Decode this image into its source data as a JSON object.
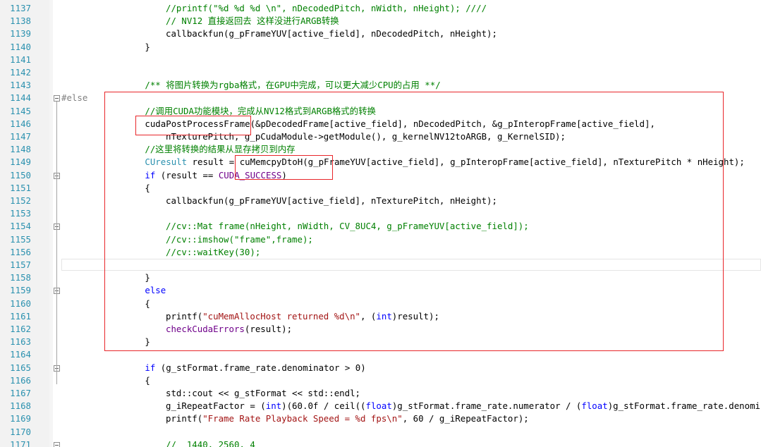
{
  "editor": {
    "lines": [
      {
        "n": "1137",
        "fold": false,
        "indent": 5,
        "tokens": [
          {
            "t": "//printf(\"%d %d %d \\n\", nDecodedPitch, nWidth, nHeight); ////",
            "c": "comment"
          }
        ]
      },
      {
        "n": "1138",
        "fold": false,
        "indent": 5,
        "tokens": [
          {
            "t": "// NV12 直接返回去 这样没进行ARGB转换",
            "c": "comment"
          }
        ]
      },
      {
        "n": "1139",
        "fold": false,
        "indent": 5,
        "tokens": [
          {
            "t": "callbackfun(g_pFrameYUV[active_field], nDecodedPitch, nHeight);",
            "c": "plain"
          }
        ]
      },
      {
        "n": "1140",
        "fold": false,
        "indent": 4,
        "tokens": [
          {
            "t": "}",
            "c": "plain"
          }
        ]
      },
      {
        "n": "1141",
        "fold": false,
        "indent": 0,
        "tokens": []
      },
      {
        "n": "1142",
        "fold": false,
        "indent": 0,
        "tokens": []
      },
      {
        "n": "1143",
        "fold": false,
        "indent": 4,
        "tokens": [
          {
            "t": "/** 将图片转换为rgba格式，在GPU中完成，可以更大减少CPU的占用 **/",
            "c": "comment"
          }
        ]
      },
      {
        "n": "1144",
        "fold": true,
        "indent": 0,
        "tokens": [
          {
            "t": "#else",
            "c": "pre"
          }
        ]
      },
      {
        "n": "1145",
        "fold": false,
        "indent": 4,
        "tokens": [
          {
            "t": "//调用CUDA功能模块，完成从NV12格式到ARGB格式的转换",
            "c": "comment"
          }
        ]
      },
      {
        "n": "1146",
        "fold": false,
        "indent": 4,
        "tokens": [
          {
            "t": "cudaPostProcessFrame",
            "c": "plain"
          },
          {
            "t": "(&pDecodedFrame[active_field], nDecodedPitch, &g_pInteropFrame[active_field],",
            "c": "plain"
          }
        ]
      },
      {
        "n": "1147",
        "fold": false,
        "indent": 5,
        "tokens": [
          {
            "t": "nTexturePitch, g_pCudaModule->getModule(), g_kernelNV12toARGB, g_KernelSID);",
            "c": "plain"
          }
        ]
      },
      {
        "n": "1148",
        "fold": false,
        "indent": 4,
        "tokens": [
          {
            "t": "//这里将转换的结果从显存拷贝到内存",
            "c": "comment"
          }
        ]
      },
      {
        "n": "1149",
        "fold": false,
        "indent": 4,
        "tokens": [
          {
            "t": "CUresult",
            "c": "type"
          },
          {
            "t": " result = ",
            "c": "plain"
          },
          {
            "t": "cuMemcpyDtoH(g_pFrameYUV[active_field], g_pInteropFrame[active_field], nTexturePitch * nHeight);",
            "c": "plain"
          }
        ]
      },
      {
        "n": "1150",
        "fold": true,
        "indent": 4,
        "tokens": [
          {
            "t": "if",
            "c": "kw"
          },
          {
            "t": " (result == ",
            "c": "plain"
          },
          {
            "t": "CUDA_SUCCESS",
            "c": "macro"
          },
          {
            "t": ")",
            "c": "plain"
          }
        ]
      },
      {
        "n": "1151",
        "fold": false,
        "indent": 4,
        "tokens": [
          {
            "t": "{",
            "c": "plain"
          }
        ]
      },
      {
        "n": "1152",
        "fold": false,
        "indent": 5,
        "tokens": [
          {
            "t": "callbackfun(g_pFrameYUV[active_field], nTexturePitch, nHeight);",
            "c": "plain"
          }
        ]
      },
      {
        "n": "1153",
        "fold": false,
        "indent": 0,
        "tokens": []
      },
      {
        "n": "1154",
        "fold": true,
        "indent": 5,
        "tokens": [
          {
            "t": "//cv::Mat frame(nHeight, nWidth, CV_8UC4, g_pFrameYUV[active_field]);",
            "c": "comment"
          }
        ]
      },
      {
        "n": "1155",
        "fold": false,
        "indent": 5,
        "tokens": [
          {
            "t": "//cv::imshow(\"frame\",frame);",
            "c": "comment"
          }
        ]
      },
      {
        "n": "1156",
        "fold": false,
        "indent": 5,
        "tokens": [
          {
            "t": "//cv::waitKey(30);",
            "c": "comment"
          }
        ]
      },
      {
        "n": "1157",
        "fold": false,
        "indent": 0,
        "tokens": []
      },
      {
        "n": "1158",
        "fold": false,
        "indent": 4,
        "tokens": [
          {
            "t": "}",
            "c": "plain"
          }
        ]
      },
      {
        "n": "1159",
        "fold": true,
        "indent": 4,
        "tokens": [
          {
            "t": "else",
            "c": "kw"
          }
        ]
      },
      {
        "n": "1160",
        "fold": false,
        "indent": 4,
        "tokens": [
          {
            "t": "{",
            "c": "plain"
          }
        ]
      },
      {
        "n": "1161",
        "fold": false,
        "indent": 5,
        "tokens": [
          {
            "t": "printf(",
            "c": "plain"
          },
          {
            "t": "\"cuMemAllocHost returned %d\\n\"",
            "c": "str"
          },
          {
            "t": ", (",
            "c": "plain"
          },
          {
            "t": "int",
            "c": "kw"
          },
          {
            "t": ")result);",
            "c": "plain"
          }
        ]
      },
      {
        "n": "1162",
        "fold": false,
        "indent": 5,
        "tokens": [
          {
            "t": "checkCudaErrors",
            "c": "macro"
          },
          {
            "t": "(result);",
            "c": "plain"
          }
        ]
      },
      {
        "n": "1163",
        "fold": false,
        "indent": 4,
        "tokens": [
          {
            "t": "}",
            "c": "plain"
          }
        ]
      },
      {
        "n": "1164",
        "fold": false,
        "indent": 0,
        "tokens": []
      },
      {
        "n": "1165",
        "fold": true,
        "indent": 4,
        "tokens": [
          {
            "t": "if",
            "c": "kw"
          },
          {
            "t": " (g_stFormat.frame_rate.denominator > 0)",
            "c": "plain"
          }
        ]
      },
      {
        "n": "1166",
        "fold": false,
        "indent": 4,
        "tokens": [
          {
            "t": "{",
            "c": "plain"
          }
        ]
      },
      {
        "n": "1167",
        "fold": false,
        "indent": 5,
        "tokens": [
          {
            "t": "std::cout << g_stFormat << std::endl;",
            "c": "plain"
          }
        ]
      },
      {
        "n": "1168",
        "fold": false,
        "indent": 5,
        "tokens": [
          {
            "t": "g_iRepeatFactor = (",
            "c": "plain"
          },
          {
            "t": "int",
            "c": "kw"
          },
          {
            "t": ")(60.0f / ceil((",
            "c": "plain"
          },
          {
            "t": "float",
            "c": "kw"
          },
          {
            "t": ")g_stFormat.frame_rate.numerator / (",
            "c": "plain"
          },
          {
            "t": "float",
            "c": "kw"
          },
          {
            "t": ")g_stFormat.frame_rate.denomin",
            "c": "plain"
          }
        ]
      },
      {
        "n": "1169",
        "fold": false,
        "indent": 5,
        "tokens": [
          {
            "t": "printf(",
            "c": "plain"
          },
          {
            "t": "\"Frame Rate Playback Speed = %d fps\\n\"",
            "c": "str"
          },
          {
            "t": ", 60 / g_iRepeatFactor);",
            "c": "plain"
          }
        ]
      },
      {
        "n": "1170",
        "fold": false,
        "indent": 0,
        "tokens": []
      },
      {
        "n": "1171",
        "fold": true,
        "indent": 5,
        "tokens": [
          {
            "t": "//  1440, 2560, 4",
            "c": "comment"
          }
        ]
      }
    ]
  }
}
